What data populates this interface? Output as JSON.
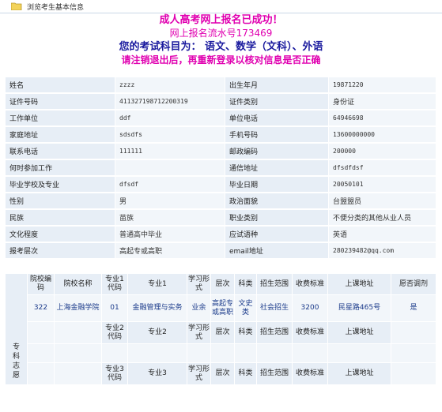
{
  "window": {
    "title": "浏览考生基本信息"
  },
  "banner": {
    "line1": "成人高考网上报名已成功！",
    "line2": "网上报名流水号173469",
    "line3": "您的考试科目为：  语文、数学（文科）、外语",
    "line4": "请注销退出后，再重新登录以核对信息是否正确"
  },
  "info": [
    {
      "l1": "姓名",
      "v1": "zzzz",
      "l2": "出生年月",
      "v2": "19871220"
    },
    {
      "l1": "证件号码",
      "v1": "411327198712200319",
      "l2": "证件类别",
      "v2": "身份证"
    },
    {
      "l1": "工作单位",
      "v1": "ddf",
      "l2": "单位电话",
      "v2": "64946698"
    },
    {
      "l1": "家庭地址",
      "v1": "sdsdfs",
      "l2": "手机号码",
      "v2": "13600000000"
    },
    {
      "l1": "联系电话",
      "v1": "111111",
      "l2": "邮政编码",
      "v2": "200000"
    },
    {
      "l1": "何时参加工作",
      "v1": "",
      "l2": "通信地址",
      "v2": "dfsdfdsf"
    },
    {
      "l1": "毕业学校及专业",
      "v1": "dfsdf",
      "l2": "毕业日期",
      "v2": "20050101"
    },
    {
      "l1": "性别",
      "v1": "男",
      "l2": "政治面貌",
      "v2": "台盟盟员"
    },
    {
      "l1": "民族",
      "v1": "苗族",
      "l2": "职业类别",
      "v2": "不便分类的其他从业人员"
    },
    {
      "l1": "文化程度",
      "v1": "普通高中毕业",
      "l2": "应试语种",
      "v2": "英语"
    },
    {
      "l1": "报考层次",
      "v1": "高起专或高职",
      "l2": "email地址",
      "v2": "280239482@qq.com"
    }
  ],
  "volunteer": {
    "side_label": "专科志愿",
    "headers": [
      "院校编码",
      "院校名称",
      "专业1代码",
      "专业1",
      "学习形式",
      "层次",
      "科类",
      "招生范围",
      "收费标准",
      "上课地址",
      "愿否调剂"
    ],
    "row1": [
      "322",
      "上海金融学院",
      "01",
      "金融管理与实务",
      "业余",
      "高起专或高职",
      "文史类",
      "社会招生",
      "3200",
      "民星路465号",
      "是"
    ],
    "h2": [
      "专业2代码",
      "专业2",
      "学习形式",
      "层次",
      "科类",
      "招生范围",
      "收费标准",
      "上课地址"
    ],
    "h3": [
      "专业3代码",
      "专业3",
      "学习形式",
      "层次",
      "科类",
      "招生范围",
      "收费标准",
      "上课地址"
    ]
  }
}
